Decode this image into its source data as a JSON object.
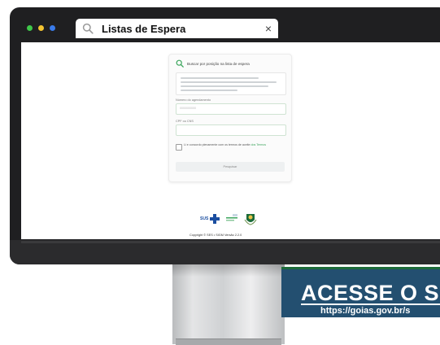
{
  "browser": {
    "tab_title": "Listas de Espera",
    "close_glyph": "×",
    "icons": {
      "search": "search-icon",
      "close": "close-icon"
    },
    "dot_colors": [
      "#3fc84a",
      "#f4c431",
      "#3a7bea"
    ]
  },
  "page": {
    "card_heading": "Buscar por posição na lista de espera",
    "field1_label": "Número do agendamento",
    "field1_placeholder": "0000000000",
    "field2_label": "CPF ou CNS",
    "consent_text": "Li e concordo plenamente com os termos de aceite ",
    "consent_link": "dos Termos",
    "submit_label": "Pesquisar",
    "sus_logo_text": "SUS",
    "copyright": "Copyright © SES • SIGM Versão 2.2.0"
  },
  "banner": {
    "heading": "ACESSE O S",
    "url": "https://goias.gov.br/s",
    "colors": {
      "bg": "#234f70",
      "accent": "#1d6b3a"
    }
  }
}
